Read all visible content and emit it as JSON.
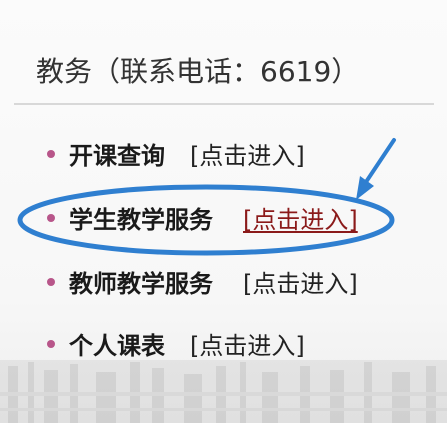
{
  "section": {
    "title": "教务（联系电话：6619）"
  },
  "menu": {
    "items": [
      {
        "label": "开课查询",
        "link": "[点击进入]"
      },
      {
        "label": "学生教学服务",
        "link": "[点击进入]"
      },
      {
        "label": "教师教学服务",
        "link": "[点击进入]"
      },
      {
        "label": "个人课表",
        "link": "[点击进入]"
      }
    ]
  },
  "colors": {
    "bullet": "#b8568a",
    "annotation": "#2f7fd0",
    "active_link": "#8b1a1a"
  },
  "icons": {
    "bullet": "bullet-dot-icon",
    "annotation_arrow": "arrow-icon",
    "annotation_ellipse": "highlight-ellipse"
  }
}
